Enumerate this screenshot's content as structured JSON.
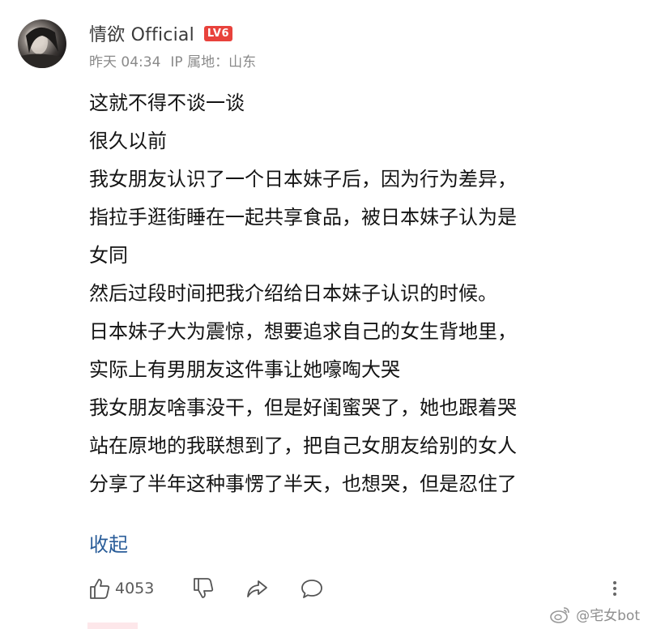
{
  "comment": {
    "username": "情欲 Official",
    "level_badge": "LV6",
    "time": "昨天 04:34",
    "ip_location": "IP 属地：山东",
    "lines": [
      "这就不得不谈一谈",
      "很久以前",
      "我女朋友认识了一个日本妹子后，因为行为差异，",
      "指拉手逛街睡在一起共享食品，被日本妹子认为是",
      "女同",
      "然后过段时间把我介绍给日本妹子认识的时候。",
      "日本妹子大为震惊，想要追求自己的女生背地里，",
      "实际上有男朋友这件事让她嚎啕大哭",
      "我女朋友啥事没干，但是好闺蜜哭了，她也跟着哭",
      "站在原地的我联想到了，把自己女朋友给别的女人",
      "分享了半年这种事愣了半天，也想哭，但是忍住了"
    ],
    "collapse_label": "收起"
  },
  "actions": {
    "like_count": "4053"
  },
  "watermark": {
    "text": "@宅女bot"
  },
  "colors": {
    "badge": "#e8423c",
    "link": "#2a5d99",
    "meta": "#8a8a8a"
  }
}
